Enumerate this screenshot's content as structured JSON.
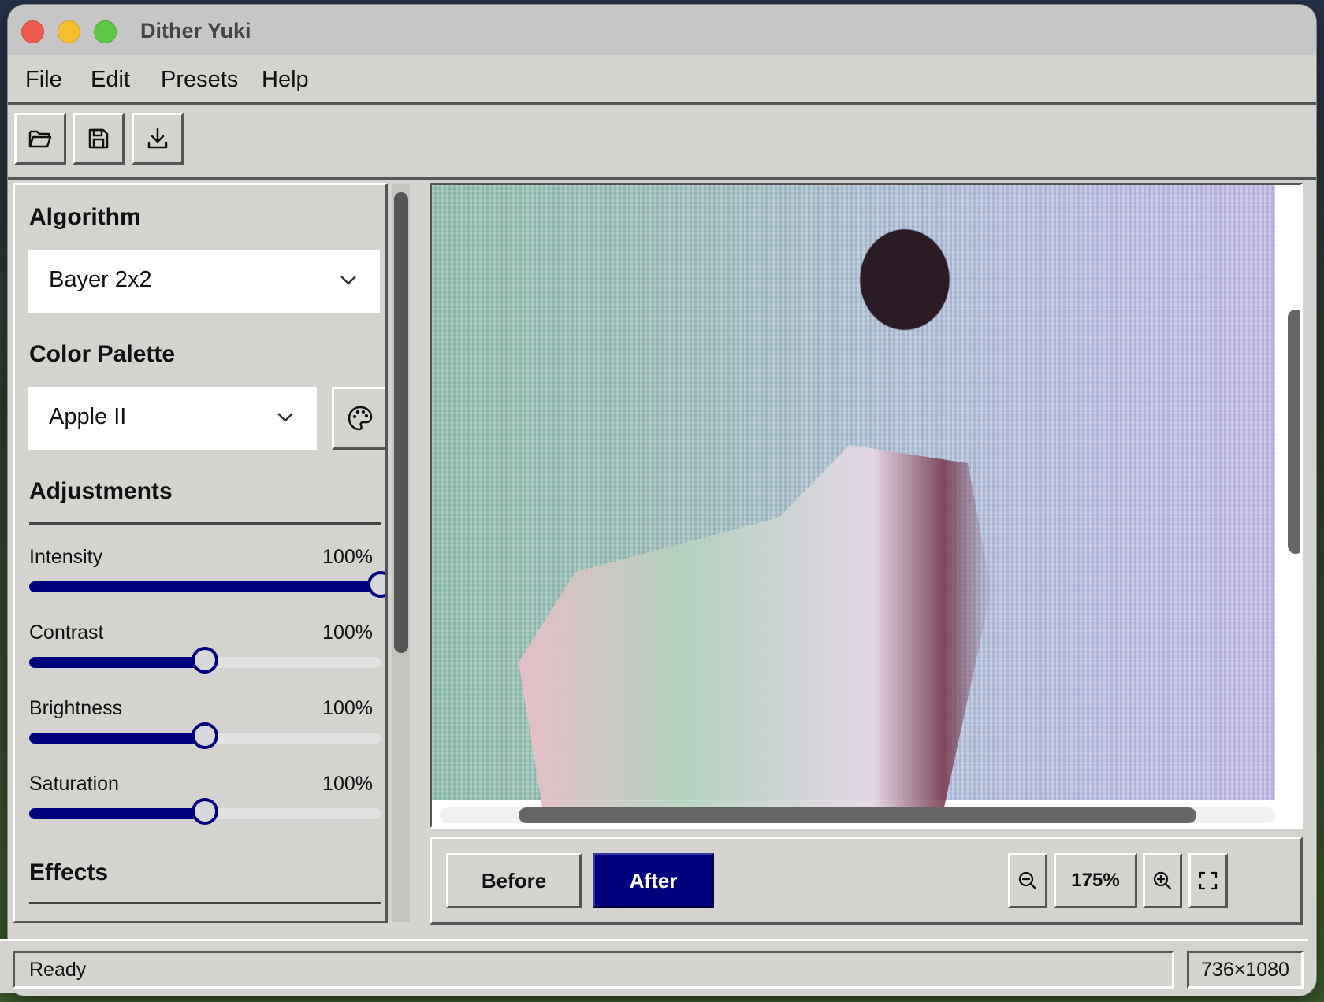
{
  "window": {
    "title": "Dither Yuki"
  },
  "menu": {
    "items": [
      "File",
      "Edit",
      "Presets",
      "Help"
    ]
  },
  "toolbar": {
    "icons": [
      "folder-open-icon",
      "save-icon",
      "download-icon"
    ]
  },
  "sidebar": {
    "algorithm": {
      "title": "Algorithm",
      "value": "Bayer 2x2"
    },
    "palette": {
      "title": "Color Palette",
      "value": "Apple II"
    },
    "adjustments": {
      "title": "Adjustments",
      "items": [
        {
          "label": "Intensity",
          "value": "100%",
          "level": 1.0
        },
        {
          "label": "Contrast",
          "value": "100%",
          "level": 0.5
        },
        {
          "label": "Brightness",
          "value": "100%",
          "level": 0.5
        },
        {
          "label": "Saturation",
          "value": "100%",
          "level": 0.5
        }
      ]
    },
    "effects": {
      "title": "Effects"
    }
  },
  "compare": {
    "before_label": "Before",
    "after_label": "After",
    "active": "After"
  },
  "zoom": {
    "level": "175%"
  },
  "status": {
    "text": "Ready",
    "dimensions": "736×1080"
  },
  "colors": {
    "accent": "#00007e",
    "window_bg": "#d4d3cf",
    "titlebar": "#c6c6c6"
  }
}
